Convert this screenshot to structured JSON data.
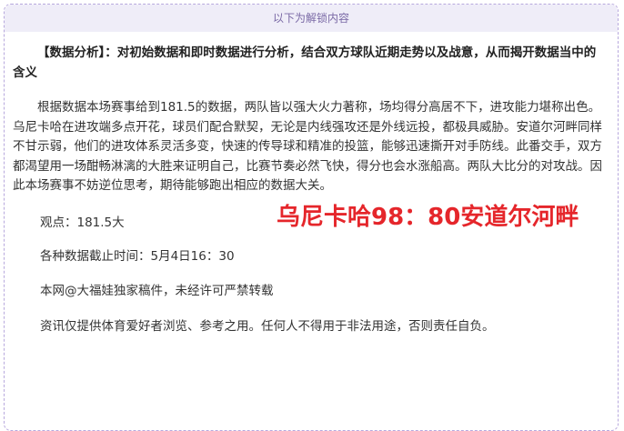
{
  "banner": {
    "label": "以下为解锁内容"
  },
  "article": {
    "heading": "【数据分析】：对初始数据和即时数据进行分析，结合双方球队近期走势以及战意，从而揭开数据当中的含义",
    "body": "根据数据本场赛事给到181.5的数据，两队皆以强大火力著称，场均得分高居不下，进攻能力堪称出色。乌尼卡哈在进攻端多点开花，球员们配合默契，无论是内线强攻还是外线远投，都极具威胁。安道尔河畔同样不甘示弱，他们的进攻体系灵活多变，快速的传导球和精准的投篮，能够迅速撕开对手防线。此番交手，双方都渴望用一场酣畅淋漓的大胜来证明自己，比赛节奏必然飞快，得分也会水涨船高。两队大比分的对攻战。因此本场赛事不妨逆位思考，期待能够跑出相应的数据大关。",
    "viewpoint": "观点：181.5大",
    "score_prediction": "乌尼卡哈98：80安道尔河畔",
    "deadline": "各种数据截止时间：5月4日16：30",
    "copyright": "本网@大福娃独家稿件，未经许可严禁转载",
    "disclaimer": "资讯仅提供体育爱好者浏览、参考之用。任何人不得用于非法用途，否则责任自负。"
  },
  "colors": {
    "accent_red": "#e5262b",
    "banner_bg": "#efedf8",
    "banner_text": "#7b6aa6",
    "border": "#b7a8dd"
  }
}
